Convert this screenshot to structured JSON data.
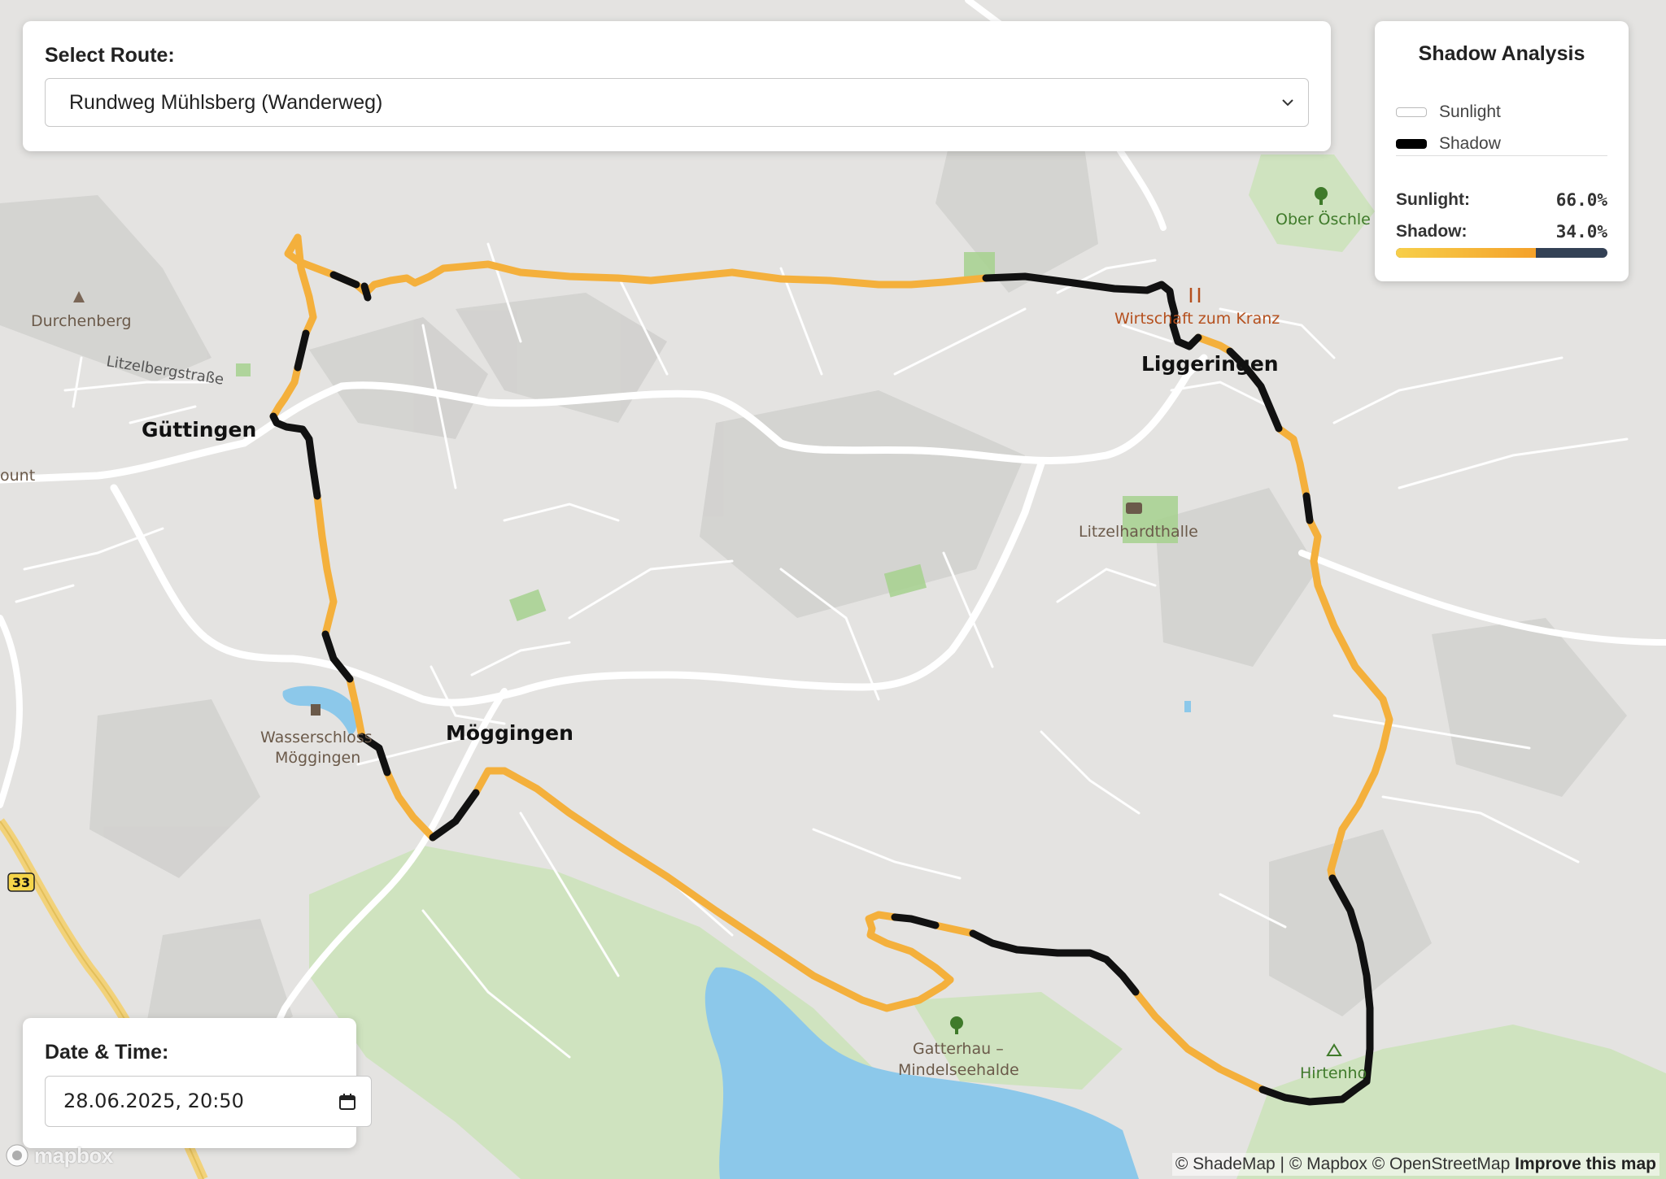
{
  "route": {
    "label": "Select Route:",
    "selected": "Rundweg Mühlsberg (Wanderweg)"
  },
  "shadow_analysis": {
    "title": "Shadow Analysis",
    "legend": {
      "sunlight": "Sunlight",
      "shadow": "Shadow"
    },
    "sunlight_label": "Sunlight:",
    "sunlight_value": "66.0%",
    "shadow_label": "Shadow:",
    "shadow_value": "34.0%",
    "sunlight_fraction": 0.66,
    "colors": {
      "sun": "#f4b03c",
      "shade": "#111111",
      "bar_shade": "#334155"
    }
  },
  "datetime": {
    "label": "Date & Time:",
    "value": "28.06.2025, 20:50"
  },
  "map": {
    "places": {
      "guettingen": "Güttingen",
      "liggeringen": "Liggeringen",
      "moeggingen": "Möggingen"
    },
    "pois": {
      "durchenberg": "Durchenberg",
      "litzelbergstrasse": "Litzelbergstraße",
      "ount": "ount",
      "wasserschloss_1": "Wasserschloss",
      "wasserschloss_2": "Möggingen",
      "ober_oeschle": "Ober Öschle",
      "wirtschaft": "Wirtschaft zum Kranz",
      "litzelhardthalle": "Litzelhardthalle",
      "gatterhau_1": "Gatterhau –",
      "gatterhau_2": "Mindelseehalde",
      "hirtenhof": "Hirtenho",
      "road_33": "33"
    },
    "colors": {
      "land": "#e4e3e1",
      "road": "#ffffff",
      "forest": "#cfe3bf",
      "water": "#8cc8ea",
      "route_sun": "#f4b03c",
      "route_shade": "#111111"
    }
  },
  "attribution": {
    "text": "© ShadeMap | © Mapbox © OpenStreetMap",
    "improve": "Improve this map"
  },
  "logo": "mapbox"
}
